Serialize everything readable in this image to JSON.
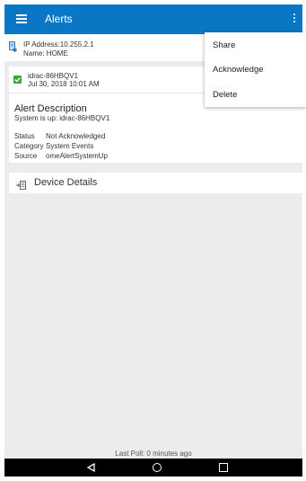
{
  "appbar": {
    "title": "Alerts",
    "menu_icon": "hamburger-menu-icon",
    "overflow_icon": "more-vert-icon",
    "color": "#0a77c5"
  },
  "device": {
    "ip_line": "IP Address:10.255.2.1",
    "name_line": "Name: HOME",
    "icon": "device-info-icon"
  },
  "alert": {
    "host": "idrac-86HBQV1",
    "timestamp": "Jul 30, 2018 10:01 AM",
    "checkbox_color": "#3aa83a",
    "description_title": "Alert Description",
    "description_text": "System is up: idrac-86HBQV1",
    "details": [
      {
        "key": "Status",
        "value": "Not Acknowledged"
      },
      {
        "key": "Category",
        "value": "System Events"
      },
      {
        "key": "Source",
        "value": "omeAlertSystemUp"
      }
    ]
  },
  "device_details": {
    "label": "Device Details",
    "icon": "device-details-icon"
  },
  "overflow_menu": {
    "items": [
      "Share",
      "Acknowledge",
      "Delete"
    ]
  },
  "footer": {
    "last_poll": "Last Poll: 0 minutes ago"
  },
  "navbar": {
    "back_icon": "back-triangle-icon",
    "home_icon": "home-circle-icon",
    "recents_icon": "recents-square-icon"
  }
}
